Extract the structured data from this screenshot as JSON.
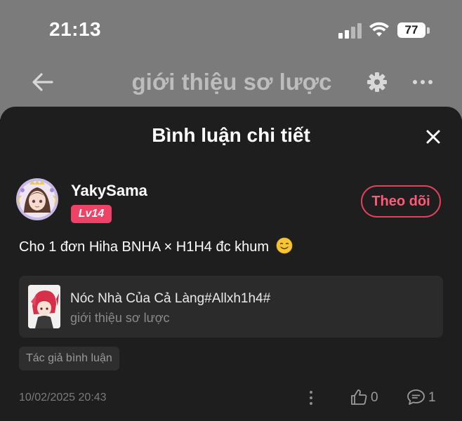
{
  "status_bar": {
    "time": "21:13",
    "battery": "77"
  },
  "nav": {
    "title": "giới thiệu sơ lược"
  },
  "sheet": {
    "title": "Bình luận chi tiết"
  },
  "comment": {
    "username": "YakySama",
    "level": "Lv14",
    "follow_label": "Theo dõi",
    "text": "Cho 1 đơn Hiha BNHA × H1H4 đc khum",
    "work": {
      "title": "Nóc Nhà Của Cả Làng#Allxh1h4#",
      "subtitle": "giới thiệu sơ lược"
    },
    "author_tag": "Tác giả bình luận",
    "timestamp": "10/02/2025 20:43",
    "like_count": "0",
    "reply_count": "1"
  },
  "colors": {
    "accent": "#ee4267",
    "sheet_bg": "#1e1e1e",
    "card_bg": "#2b2b2b"
  }
}
